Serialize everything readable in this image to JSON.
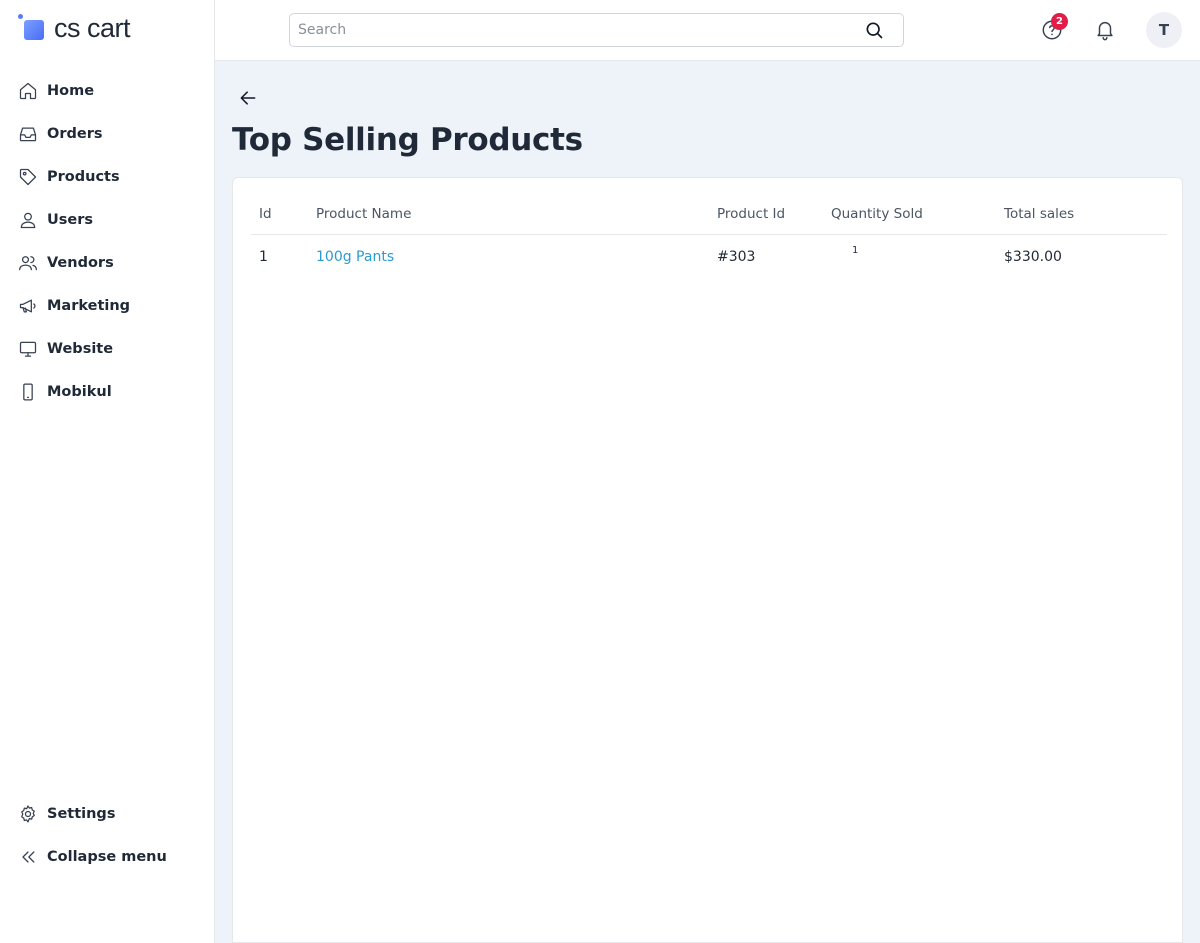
{
  "brand": {
    "name": "cs cart",
    "accent": "#4a6cf7"
  },
  "sidebar": {
    "items": [
      {
        "label": "Home",
        "icon": "home-icon"
      },
      {
        "label": "Orders",
        "icon": "inbox-icon"
      },
      {
        "label": "Products",
        "icon": "tag-icon"
      },
      {
        "label": "Users",
        "icon": "user-icon"
      },
      {
        "label": "Vendors",
        "icon": "users-icon"
      },
      {
        "label": "Marketing",
        "icon": "megaphone-icon"
      },
      {
        "label": "Website",
        "icon": "monitor-icon"
      },
      {
        "label": "Mobikul",
        "icon": "smartphone-icon"
      }
    ],
    "bottom": [
      {
        "label": "Settings",
        "icon": "gear-icon"
      },
      {
        "label": "Collapse menu",
        "icon": "chevrons-left-icon"
      }
    ]
  },
  "header": {
    "search": {
      "placeholder": "Search",
      "value": ""
    },
    "help_badge": "2",
    "badge_color": "#e11d48",
    "avatar_initial": "T"
  },
  "page": {
    "title": "Top Selling Products"
  },
  "table": {
    "columns": [
      "Id",
      "Product Name",
      "Product Id",
      "Quantity Sold",
      "Total sales"
    ],
    "rows": [
      {
        "id": "1",
        "product_name": "100g Pants",
        "product_id": "#303",
        "quantity_sold": "1",
        "total_sales": "$330.00"
      }
    ],
    "link_color": "#2a9bd1"
  }
}
